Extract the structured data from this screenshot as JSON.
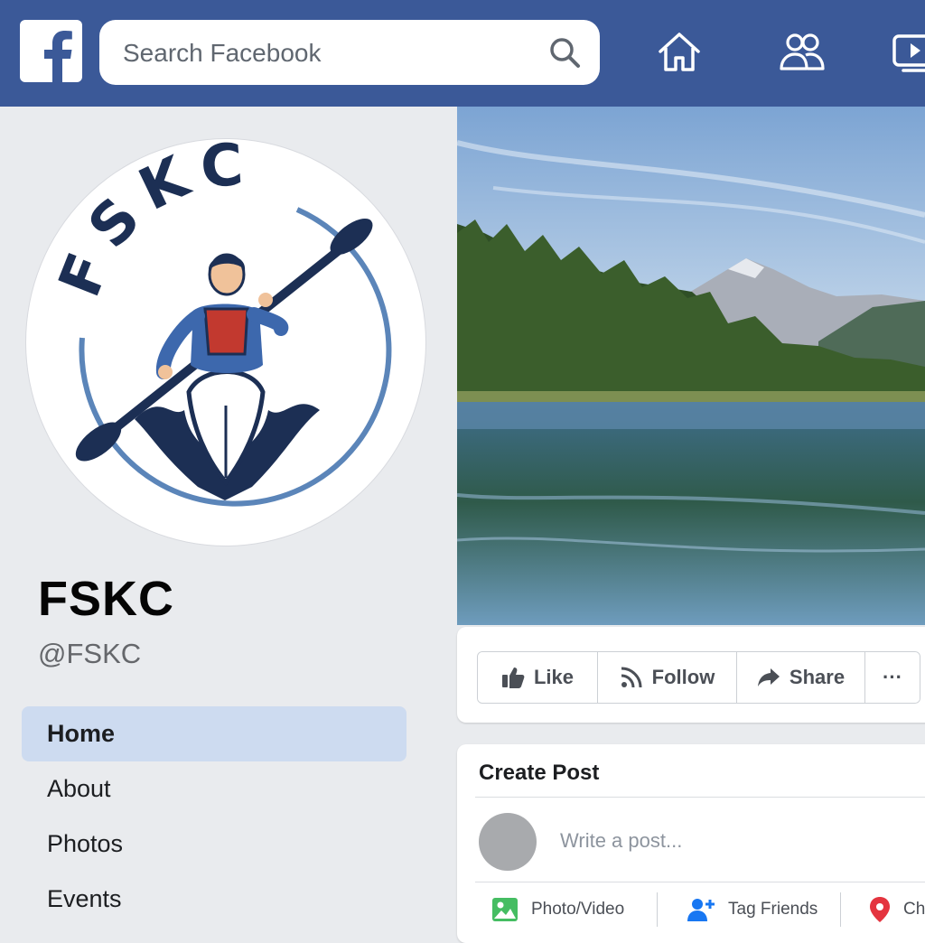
{
  "header": {
    "logo_letter": "f",
    "search_placeholder": "Search Facebook",
    "nav_icons": [
      "home-icon",
      "friends-icon",
      "watch-icon"
    ],
    "brand_color": "#3b5998"
  },
  "profile": {
    "logo_text": "FSKC",
    "name": "FSKC",
    "handle": "@FSKC"
  },
  "sidebar": {
    "items": [
      {
        "label": "Home",
        "active": true
      },
      {
        "label": "About",
        "active": false
      },
      {
        "label": "Photos",
        "active": false
      },
      {
        "label": "Events",
        "active": false
      }
    ]
  },
  "actions": {
    "like": "Like",
    "follow": "Follow",
    "share": "Share",
    "more": "···"
  },
  "create_post": {
    "title": "Create Post",
    "placeholder": "Write a post...",
    "options": [
      {
        "label": "Photo/Video",
        "icon": "photo-icon"
      },
      {
        "label": "Tag Friends",
        "icon": "tag-friends-icon"
      },
      {
        "label": "Che",
        "icon": "location-pin-icon"
      }
    ]
  }
}
